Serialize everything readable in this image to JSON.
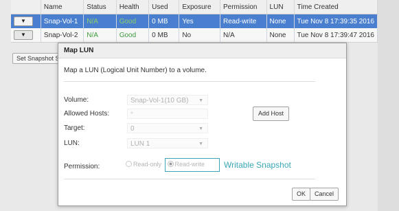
{
  "table": {
    "headers": [
      "Name",
      "Status",
      "Health",
      "Used",
      "Exposure",
      "Permission",
      "LUN",
      "Time Created"
    ],
    "rows": [
      {
        "expander": "▼",
        "name": "Snap-Vol-1",
        "status": "N/A",
        "health": "Good",
        "used": "0 MB",
        "exposure": "Yes",
        "permission": "Read-write",
        "lun": "None",
        "time": "Tue Nov 8 17:39:35 2016",
        "selected": true
      },
      {
        "expander": "▼",
        "name": "Snap-Vol-2",
        "status": "N/A",
        "health": "Good",
        "used": "0 MB",
        "exposure": "No",
        "permission": "N/A",
        "lun": "None",
        "time": "Tue Nov 8 17:39:47 2016",
        "selected": false
      }
    ]
  },
  "toolbar": {
    "set_snapshot_label": "Set Snapshot Sp"
  },
  "dialog": {
    "title": "Map LUN",
    "description": "Map a LUN (Logical Unit Number) to a volume.",
    "volume_label": "Volume:",
    "volume_value": "Snap-Vol-1(10 GB)",
    "allowed_hosts_label": "Allowed Hosts:",
    "allowed_hosts_value": "*",
    "add_host_label": "Add Host",
    "target_label": "Target:",
    "target_value": "0",
    "lun_label": "LUN:",
    "lun_value": "LUN 1",
    "permission_label": "Permission:",
    "perm_readonly": "Read-only",
    "perm_readwrite": "Read-write",
    "ok_label": "OK",
    "cancel_label": "Cancel"
  },
  "annotation": {
    "text": "Writable Snapshot",
    "color": "#3aa6b8"
  },
  "colors": {
    "selected_row": "#4a7fd0",
    "good_health": "#3d9a3d"
  },
  "icons": {
    "expander": "chevron-down-icon",
    "dropdown": "caret-down-icon"
  }
}
